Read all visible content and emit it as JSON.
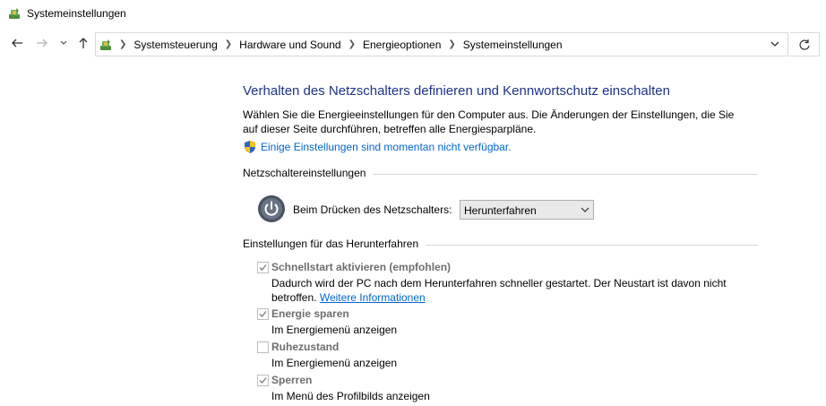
{
  "window": {
    "title": "Systemeinstellungen",
    "icon": "power-options-icon"
  },
  "nav": {
    "back_icon": "back-arrow-icon",
    "forward_icon": "forward-arrow-icon",
    "recent_icon": "chevron-down-icon",
    "up_icon": "up-arrow-icon",
    "refresh_icon": "refresh-icon"
  },
  "breadcrumbs": [
    "Systemsteuerung",
    "Hardware und Sound",
    "Energieoptionen",
    "Systemeinstellungen"
  ],
  "page": {
    "heading": "Verhalten des Netzschalters definieren und Kennwortschutz einschalten",
    "intro": "Wählen Sie die Energieeinstellungen für den Computer aus. Die Änderungen der Einstellungen, die Sie auf dieser Seite durchführen, betreffen alle Energiesparpläne.",
    "unavailable_link": "Einige Einstellungen sind momentan nicht verfügbar."
  },
  "power_button": {
    "section_label": "Netzschaltereinstellungen",
    "label": "Beim Drücken des Netzschalters:",
    "selected": "Herunterfahren"
  },
  "shutdown": {
    "section_label": "Einstellungen für das Herunterfahren",
    "options": [
      {
        "label": "Schnellstart aktivieren (empfohlen)",
        "checked": true,
        "desc": "Dadurch wird der PC nach dem Herunterfahren schneller gestartet. Der Neustart ist davon nicht betroffen.",
        "link": "Weitere Informationen"
      },
      {
        "label": "Energie sparen",
        "checked": true,
        "desc": "Im Energiemenü anzeigen"
      },
      {
        "label": "Ruhezustand",
        "checked": false,
        "desc": "Im Energiemenü anzeigen"
      },
      {
        "label": "Sperren",
        "checked": true,
        "desc": "Im Menü des Profilbilds anzeigen"
      }
    ]
  },
  "colors": {
    "heading": "#1e3287",
    "link": "#0066cc",
    "disabled_label": "#6d6d6d"
  }
}
